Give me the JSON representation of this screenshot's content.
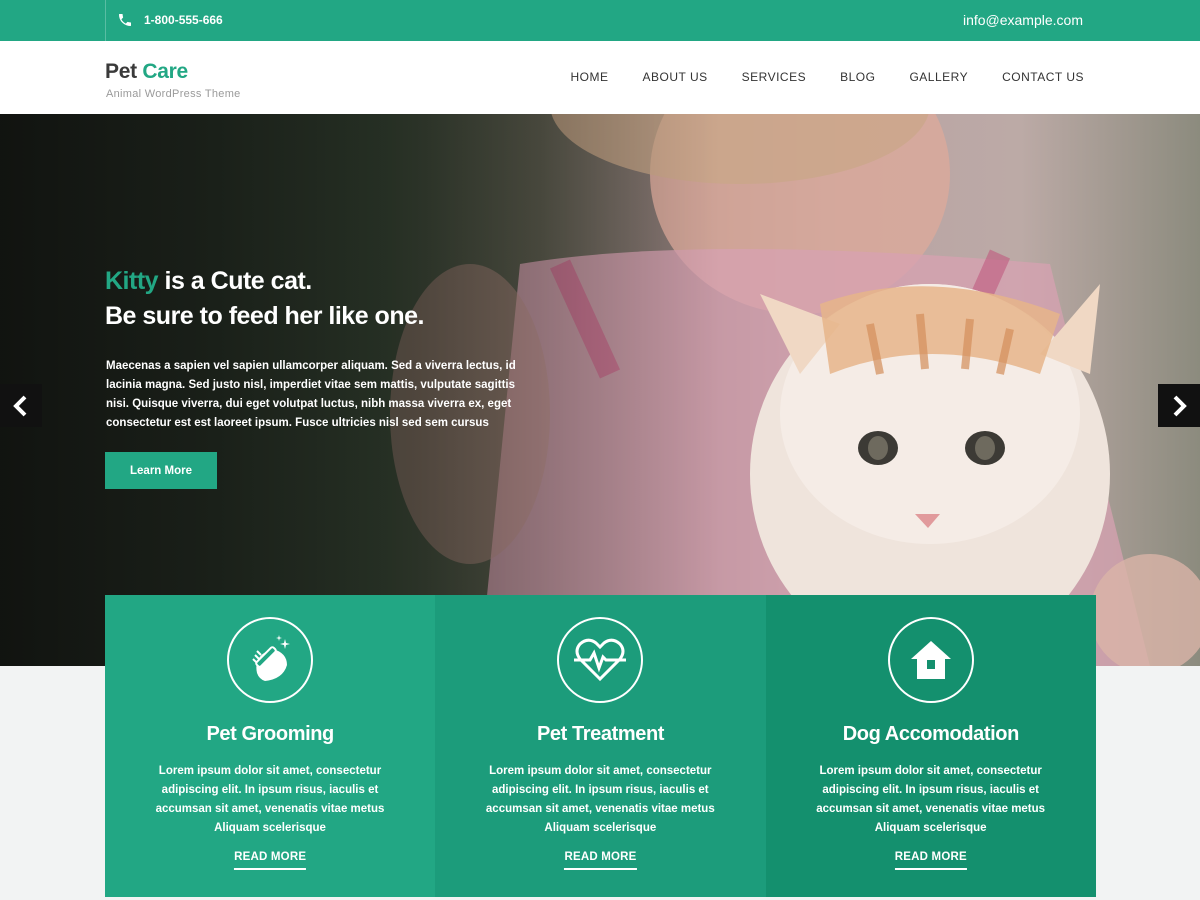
{
  "topbar": {
    "phone": "1-800-555-666",
    "email": "info@example.com",
    "phone_icon": "phone-icon"
  },
  "header": {
    "logo_part1": "Pet",
    "logo_part2": "Care",
    "tagline": "Animal WordPress Theme",
    "nav": [
      "HOME",
      "ABOUT US",
      "SERVICES",
      "BLOG",
      "GALLERY",
      "CONTACT US"
    ]
  },
  "hero": {
    "title_highlight": "Kitty",
    "title_rest": "is a Cute cat.",
    "title_line2": "Be sure to feed her like one.",
    "body": "Maecenas a sapien vel sapien ullamcorper aliquam. Sed a viverra lectus, id lacinia magna. Sed justo nisl, imperdiet vitae sem mattis, vulputate sagittis nisi. Quisque viverra, dui eget volutpat luctus, nibh massa viverra ex, eget consectetur est est laoreet ipsum. Fusce ultricies nisl sed sem cursus",
    "button": "Learn More",
    "prev_icon": "chevron-left-icon",
    "next_icon": "chevron-right-icon"
  },
  "cards": [
    {
      "icon": "grooming-brush-icon",
      "title": "Pet Grooming",
      "text": "Lorem ipsum dolor sit amet, consectetur adipiscing elit. In ipsum risus, iaculis et accumsan sit amet, venenatis vitae metus Aliquam scelerisque",
      "link": "READ MORE"
    },
    {
      "icon": "heartbeat-icon",
      "title": "Pet Treatment",
      "text": "Lorem ipsum dolor sit amet, consectetur adipiscing elit. In ipsum risus, iaculis et accumsan sit amet, venenatis vitae metus Aliquam scelerisque",
      "link": "READ MORE"
    },
    {
      "icon": "house-icon",
      "title": "Dog Accomodation",
      "text": "Lorem ipsum dolor sit amet, consectetur adipiscing elit. In ipsum risus, iaculis et accumsan sit amet, venenatis vitae metus Aliquam scelerisque",
      "link": "READ MORE"
    }
  ],
  "colors": {
    "brand": "#22a784",
    "card1": "#22a784",
    "card2": "#1c9c7b",
    "card3": "#14906e"
  }
}
